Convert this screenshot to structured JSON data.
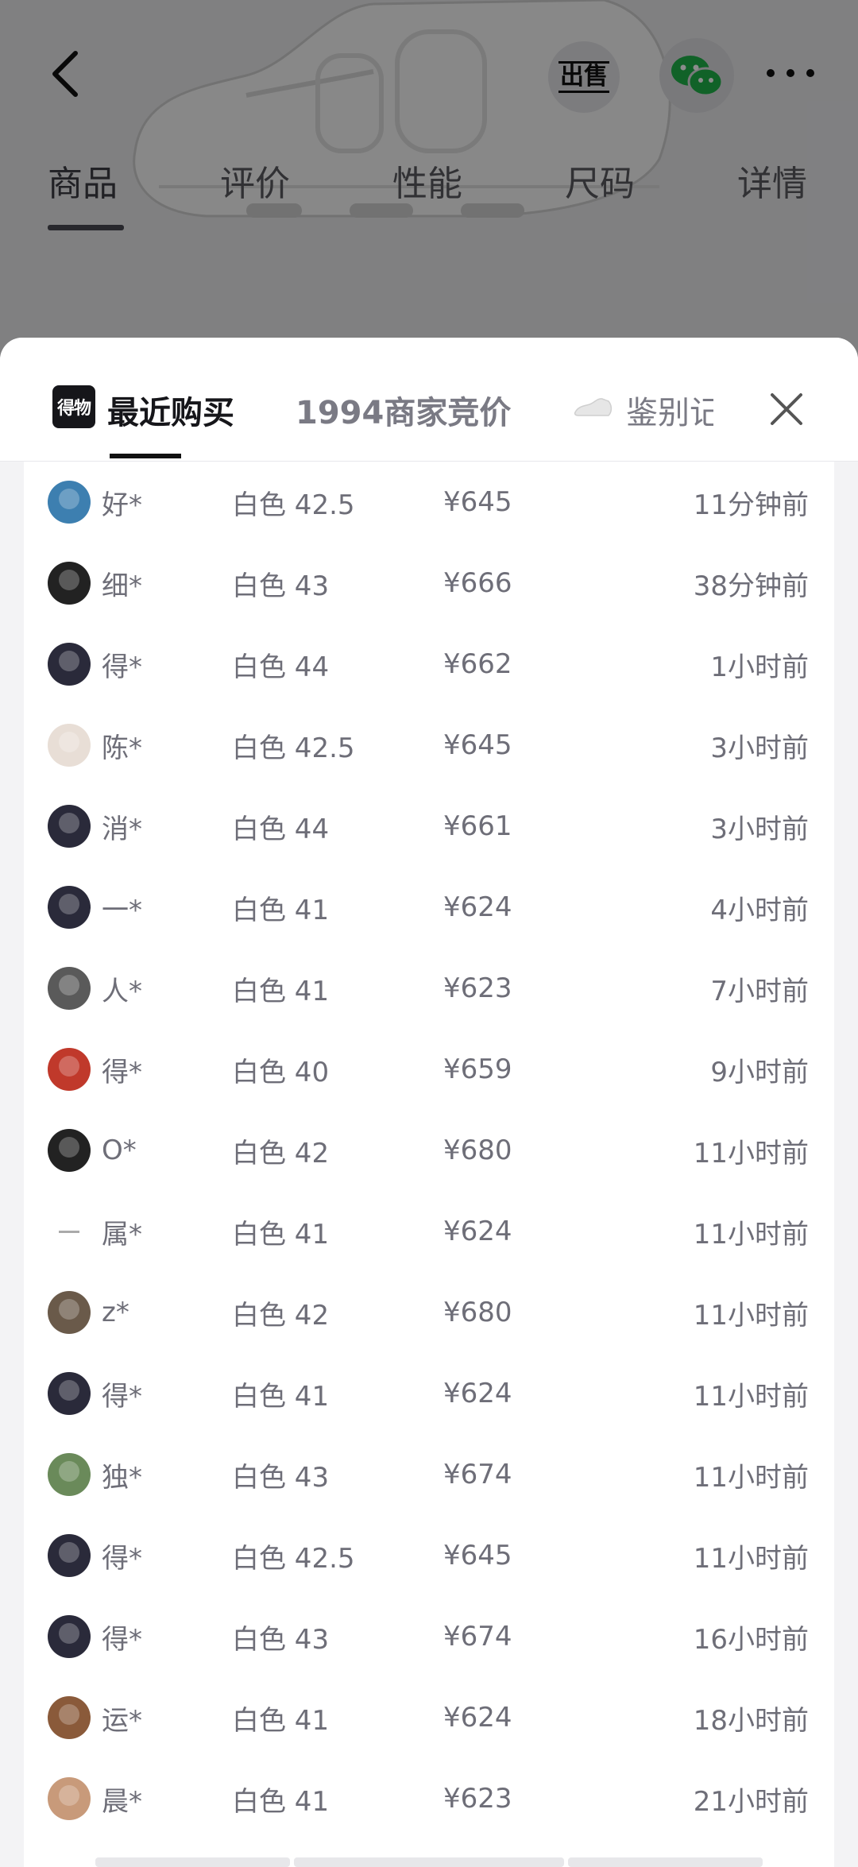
{
  "header": {
    "sell_label": "出售",
    "tabs": [
      "商品",
      "评价",
      "性能",
      "尺码",
      "详情"
    ],
    "active_tab": 0
  },
  "sheet": {
    "brand_logo_text": "得物",
    "tabs": [
      "最近购买",
      "1994商家竞价",
      "鉴别记录"
    ],
    "active_tab": 0
  },
  "purchases": [
    {
      "name": "好*",
      "spec": "白色 42.5",
      "price": "¥645",
      "time": "11分钟前",
      "avatar": "#3d7fb0"
    },
    {
      "name": "细*",
      "spec": "白色 43",
      "price": "¥666",
      "time": "38分钟前",
      "avatar": "#222222"
    },
    {
      "name": "得*",
      "spec": "白色 44",
      "price": "¥662",
      "time": "1小时前",
      "avatar": "#2a2a3a"
    },
    {
      "name": "陈*",
      "spec": "白色 42.5",
      "price": "¥645",
      "time": "3小时前",
      "avatar": "#e8ded6"
    },
    {
      "name": "消*",
      "spec": "白色 44",
      "price": "¥661",
      "time": "3小时前",
      "avatar": "#2a2a3a"
    },
    {
      "name": "一*",
      "spec": "白色 41",
      "price": "¥624",
      "time": "4小时前",
      "avatar": "#2a2a3a"
    },
    {
      "name": "人*",
      "spec": "白色 41",
      "price": "¥623",
      "time": "7小时前",
      "avatar": "#5a5a5a"
    },
    {
      "name": "得*",
      "spec": "白色 40",
      "price": "¥659",
      "time": "9小时前",
      "avatar": "#c0392b"
    },
    {
      "name": "O*",
      "spec": "白色 42",
      "price": "¥680",
      "time": "11小时前",
      "avatar": "#222222"
    },
    {
      "name": "属*",
      "spec": "白色 41",
      "price": "¥624",
      "time": "11小时前",
      "avatar": "#ffffff"
    },
    {
      "name": "z*",
      "spec": "白色 42",
      "price": "¥680",
      "time": "11小时前",
      "avatar": "#6a5a4a"
    },
    {
      "name": "得*",
      "spec": "白色 41",
      "price": "¥624",
      "time": "11小时前",
      "avatar": "#2a2a3a"
    },
    {
      "name": "独*",
      "spec": "白色 43",
      "price": "¥674",
      "time": "11小时前",
      "avatar": "#6a8a5a"
    },
    {
      "name": "得*",
      "spec": "白色 42.5",
      "price": "¥645",
      "time": "11小时前",
      "avatar": "#2a2a3a"
    },
    {
      "name": "得*",
      "spec": "白色 43",
      "price": "¥674",
      "time": "16小时前",
      "avatar": "#2a2a3a"
    },
    {
      "name": "运*",
      "spec": "白色 41",
      "price": "¥624",
      "time": "18小时前",
      "avatar": "#8a5a3a"
    },
    {
      "name": "晨*",
      "spec": "白色 41",
      "price": "¥623",
      "time": "21小时前",
      "avatar": "#c89a7a"
    }
  ],
  "colors": {
    "accent": "#111111",
    "text_secondary": "#6e6e78"
  }
}
